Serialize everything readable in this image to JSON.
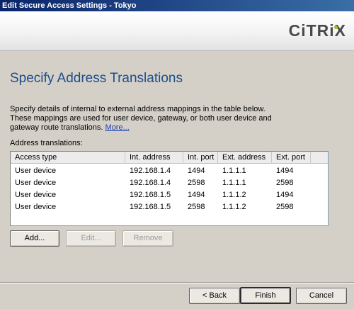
{
  "window": {
    "title": "Edit Secure Access Settings - Tokyo"
  },
  "brand": {
    "logo_text": "CiTRiX",
    "accent": "#9bbf1a"
  },
  "page": {
    "heading": "Specify Address Translations",
    "description": "Specify details of internal to external address mappings in the table below. These mappings are used for user device, gateway, or both user device and gateway route translations.",
    "more_link": "More...",
    "list_label": "Address translations:"
  },
  "table": {
    "columns": [
      "Access type",
      "Int. address",
      "Int. port",
      "Ext. address",
      "Ext. port"
    ],
    "rows": [
      [
        "User device",
        "192.168.1.4",
        "1494",
        "1.1.1.1",
        "1494"
      ],
      [
        "User device",
        "192.168.1.4",
        "2598",
        "1.1.1.1",
        "2598"
      ],
      [
        "User device",
        "192.168.1.5",
        "1494",
        "1.1.1.2",
        "1494"
      ],
      [
        "User device",
        "192.168.1.5",
        "2598",
        "1.1.1.2",
        "2598"
      ]
    ]
  },
  "actions": {
    "add": "Add...",
    "edit": "Edit...",
    "remove": "Remove"
  },
  "footer": {
    "back": "< Back",
    "finish": "Finish",
    "cancel": "Cancel"
  }
}
